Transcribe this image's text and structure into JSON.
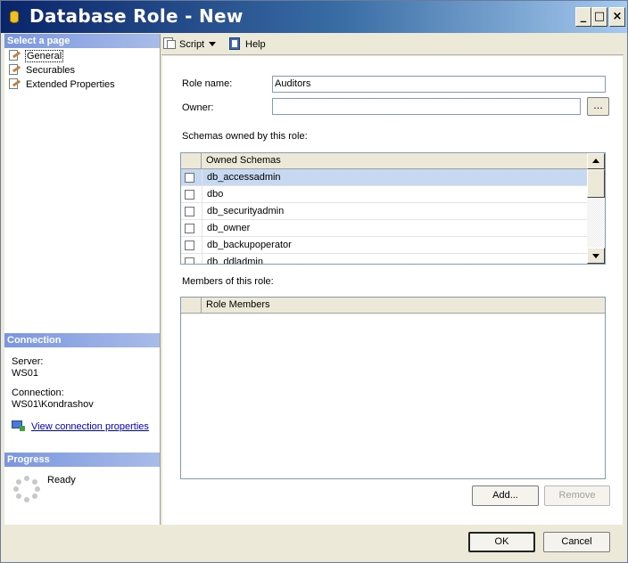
{
  "window": {
    "title": "Database Role - New",
    "controls": {
      "minimize": "_",
      "maximize": "□",
      "close": "×"
    }
  },
  "left_panel": {
    "select_page_header": "Select a page",
    "pages": [
      {
        "label": "General",
        "icon": "wrench-page-icon",
        "selected": true
      },
      {
        "label": "Securables",
        "icon": "wrench-page-icon",
        "selected": false
      },
      {
        "label": "Extended Properties",
        "icon": "wrench-page-icon",
        "selected": false
      }
    ],
    "connection_header": "Connection",
    "server_label": "Server:",
    "server_value": "WS01",
    "connection_label": "Connection:",
    "connection_value": "WS01\\Kondrashov",
    "view_connection_link": "View connection properties",
    "progress_header": "Progress",
    "progress_status": "Ready"
  },
  "toolbar": {
    "script_label": "Script",
    "help_label": "Help"
  },
  "form": {
    "role_name_label": "Role name:",
    "role_name_value": "Auditors",
    "owner_label": "Owner:",
    "owner_value": "",
    "browse_label": "...",
    "schemas_label": "Schemas owned by this role:",
    "members_label": "Members of this role:"
  },
  "schemas_grid": {
    "column_header": "Owned Schemas",
    "rows": [
      {
        "name": "db_accessadmin",
        "checked": false,
        "selected": true
      },
      {
        "name": "dbo",
        "checked": false,
        "selected": false
      },
      {
        "name": "db_securityadmin",
        "checked": false,
        "selected": false
      },
      {
        "name": "db_owner",
        "checked": false,
        "selected": false
      },
      {
        "name": "db_backupoperator",
        "checked": false,
        "selected": false
      },
      {
        "name": "db_ddladmin",
        "checked": false,
        "selected": false
      }
    ]
  },
  "members_grid": {
    "column_header": "Role Members"
  },
  "buttons": {
    "add": "Add...",
    "remove": "Remove",
    "ok": "OK",
    "cancel": "Cancel"
  }
}
